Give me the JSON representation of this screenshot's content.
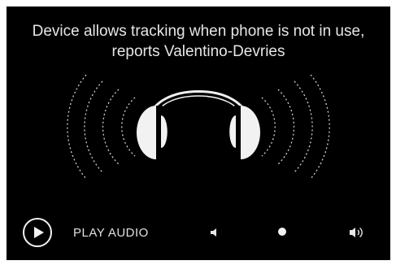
{
  "player": {
    "headline": "Device allows tracking when phone is not in use, reports Valentino-Devries",
    "art_icon": "headphones-icon",
    "controls": {
      "play_icon": "play-icon",
      "play_label": "PLAY AUDIO",
      "volume_low_icon": "volume-low-icon",
      "volume_level": 0.5,
      "volume_high_icon": "volume-high-icon"
    }
  }
}
